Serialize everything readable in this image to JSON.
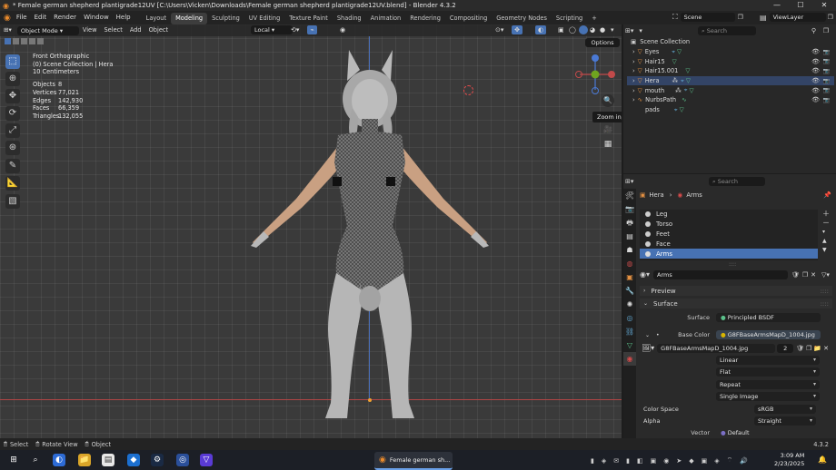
{
  "window": {
    "title": "* Female german shepherd plantigrade12UV [C:\\Users\\Vicken\\Downloads\\Female german shepherd plantigrade12UV.blend] - Blender 4.3.2",
    "minimize": "—",
    "maximize": "☐",
    "close": "✕"
  },
  "menubar": {
    "items": [
      "File",
      "Edit",
      "Render",
      "Window",
      "Help"
    ],
    "workspaces": [
      "Layout",
      "Modeling",
      "Sculpting",
      "UV Editing",
      "Texture Paint",
      "Shading",
      "Animation",
      "Rendering",
      "Compositing",
      "Geometry Nodes",
      "Scripting"
    ],
    "active_workspace": "Modeling",
    "add_workspace": "+",
    "scene": "Scene",
    "view_layer": "ViewLayer"
  },
  "viewport_header": {
    "mode": "Object Mode",
    "menus": [
      "View",
      "Select",
      "Add",
      "Object"
    ],
    "orientation": "Local",
    "options": "Options"
  },
  "overlay_stats": {
    "view_name": "Front Orthographic",
    "collection": "(0) Scene Collection | Hera",
    "scale": "10 Centimeters",
    "rows": [
      {
        "label": "Objects",
        "value": "8"
      },
      {
        "label": "Vertices",
        "value": "77,021"
      },
      {
        "label": "Edges",
        "value": "142,930"
      },
      {
        "label": "Faces",
        "value": "66,359"
      },
      {
        "label": "Triangles",
        "value": "132,055"
      }
    ]
  },
  "tooltip": "Zoom in/out in the view",
  "outliner": {
    "search_placeholder": "Search",
    "root": "Scene Collection",
    "items": [
      "Eyes",
      "Hair15",
      "Hair15.001",
      "Hera",
      "mouth",
      "NurbsPath",
      "pads"
    ]
  },
  "properties": {
    "search_placeholder": "Search",
    "breadcrumb_object": "Hera",
    "breadcrumb_material": "Arms",
    "material_slots": [
      "Leg",
      "Torso",
      "Feet",
      "Face",
      "Arms"
    ],
    "active_slot": "Arms",
    "material_name": "Arms",
    "panels": {
      "preview": "Preview",
      "surface": "Surface"
    },
    "surface_label": "Surface",
    "surface_value": "Principled BSDF",
    "base_color_label": "Base Color",
    "base_color_value": "G8FBaseArmsMapD_1004.jpg",
    "image_name": "G8FBaseArmsMapD_1004.jpg",
    "image_users": "2",
    "interpolation": "Linear",
    "projection": "Flat",
    "extension": "Repeat",
    "source": "Single Image",
    "color_space_label": "Color Space",
    "color_space": "sRGB",
    "alpha_label": "Alpha",
    "alpha": "Straight",
    "vector_label": "Vector",
    "vector": "Default"
  },
  "statusbar": {
    "select": "Select",
    "rotate": "Rotate View",
    "object": "Object",
    "version": "4.3.2"
  },
  "taskbar": {
    "active_app": "Female german sh...",
    "time": "3:09 AM",
    "date": "2/23/2025"
  },
  "colors": {
    "accent": "#4772b3",
    "active_row": "#4772b3",
    "xaxis": "#c24a4a",
    "yaxis": "#6fa41f",
    "zaxis": "#4a79d4",
    "material_yellow": "#d8b400"
  }
}
